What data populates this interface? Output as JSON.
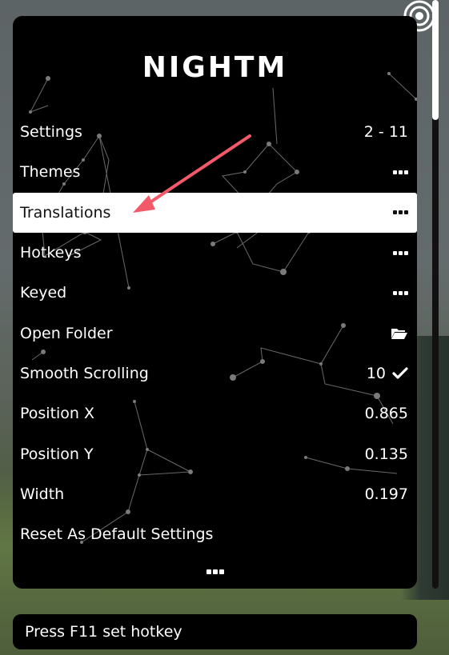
{
  "app": {
    "title": "NIGHTM"
  },
  "menu": {
    "items": [
      {
        "label": "Settings",
        "value": "2 - 11"
      },
      {
        "label": "Themes",
        "value_icon": "more-dots-icon"
      },
      {
        "label": "Translations",
        "value_icon": "more-dots-icon",
        "selected": true
      },
      {
        "label": "Hotkeys",
        "value_icon": "more-dots-icon"
      },
      {
        "label": "Keyed",
        "value_icon": "more-dots-icon"
      },
      {
        "label": "Open Folder",
        "value_icon": "folder-open-icon"
      },
      {
        "label": "Smooth Scrolling",
        "value": "10",
        "value_icon": "check-icon"
      },
      {
        "label": "Position X",
        "value": "0.865"
      },
      {
        "label": "Position Y",
        "value": "0.135"
      },
      {
        "label": "Width",
        "value": "0.197"
      },
      {
        "label": "Reset As Default Settings"
      }
    ],
    "more_icon": "more-dots-icon"
  },
  "status": {
    "text": "Press F11 set hotkey"
  },
  "colors": {
    "panel": "#000000",
    "selected_row": "#ffffff",
    "annotation_arrow": "#f25a6a"
  }
}
